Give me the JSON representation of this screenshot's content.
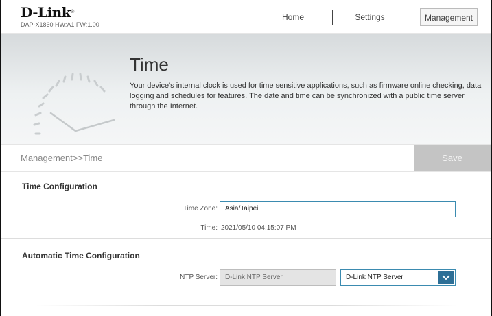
{
  "header": {
    "logo": "D-Link",
    "model": "DAP-X1860 HW:A1 FW:1.00",
    "nav": [
      {
        "label": "Home"
      },
      {
        "label": "Settings"
      },
      {
        "label": "Management"
      }
    ]
  },
  "banner": {
    "title": "Time",
    "description": "Your device's internal clock is used for time sensitive applications, such as firmware online checking, data logging and schedules for features. The date and time can be synchronized with a public time server through the Internet.",
    "icon": "clock-gauge-icon"
  },
  "breadcrumb": "Management>>Time",
  "save_label": "Save",
  "time_config": {
    "title": "Time Configuration",
    "time_zone_label": "Time Zone:",
    "time_zone_value": "Asia/Taipei",
    "time_label": "Time:",
    "time_value": "2021/05/10 04:15:07 PM"
  },
  "auto_time": {
    "title": "Automatic Time Configuration",
    "ntp_label": "NTP Server:",
    "ntp_value": "D-Link NTP Server",
    "ntp_select_value": "D-Link NTP Server"
  },
  "colors": {
    "accent": "#2d6f96",
    "save_disabled": "#c4c4c4"
  }
}
